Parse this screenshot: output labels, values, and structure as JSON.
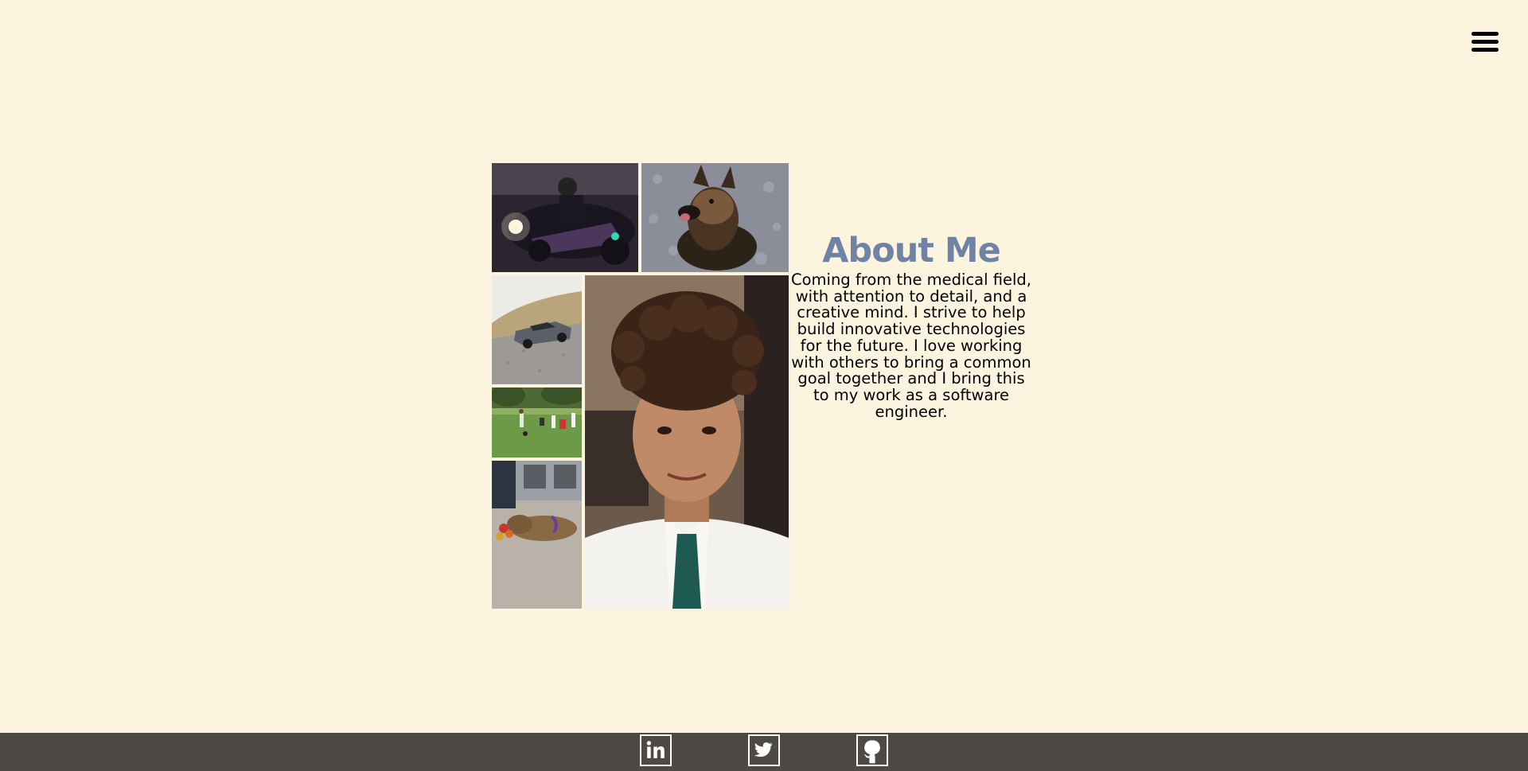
{
  "header": {
    "menu_icon": "hamburger-menu-icon"
  },
  "collage": {
    "photos": [
      {
        "subject": "motorcycle-at-night"
      },
      {
        "subject": "german-shepherd-dog"
      },
      {
        "subject": "sports-car-on-gravel"
      },
      {
        "subject": "people-golfing-on-grass"
      },
      {
        "subject": "puppy-with-toys"
      },
      {
        "subject": "portrait-curly-hair-tie"
      }
    ]
  },
  "about": {
    "title": "About Me",
    "bio": "Coming from the medical field, with attention to detail, and a creative mind. I strive to help build innovative technologies for the future. I love working with others to bring a common goal together and I bring this to my work as a software engineer."
  },
  "footer": {
    "links": [
      {
        "name": "linkedin",
        "icon": "linkedin-icon"
      },
      {
        "name": "twitter",
        "icon": "twitter-icon"
      },
      {
        "name": "github",
        "icon": "github-icon"
      }
    ]
  },
  "colors": {
    "background": "#fdf4df",
    "title": "#6f83a4",
    "footer": "#4d4a45"
  }
}
